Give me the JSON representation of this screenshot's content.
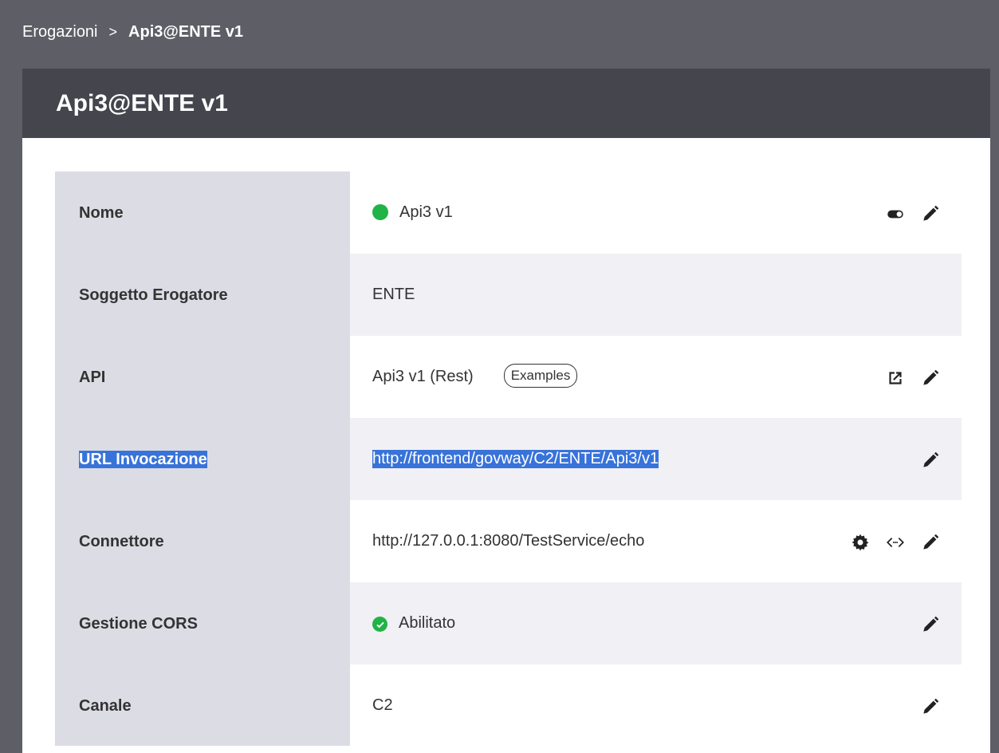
{
  "breadcrumb": {
    "parent": "Erogazioni",
    "separator": ">",
    "current": "Api3@ENTE v1"
  },
  "panel": {
    "title": "Api3@ENTE v1"
  },
  "rows": [
    {
      "label": "Nome",
      "value": "Api3 v1"
    },
    {
      "label": "Soggetto Erogatore",
      "value": "ENTE"
    },
    {
      "label": "API",
      "value": "Api3 v1 (Rest)",
      "tag": "Examples"
    },
    {
      "label": "URL Invocazione",
      "value": "http://frontend/govway/C2/ENTE/Api3/v1"
    },
    {
      "label": "Connettore",
      "value": "http://127.0.0.1:8080/TestService/echo"
    },
    {
      "label": "Gestione CORS",
      "value": "Abilitato"
    },
    {
      "label": "Canale",
      "value": "C2"
    }
  ],
  "icons": {
    "status": "status-dot-icon",
    "toggle": "toggle-icon",
    "edit": "pencil-icon",
    "open": "open-in-new-icon",
    "settings": "gear-icon",
    "code": "code-arrows-icon",
    "check": "check-circle-icon"
  },
  "colors": {
    "background": "#5d5e66",
    "header": "#44454d",
    "label_column": "#dcdce4",
    "alt_row": "#f0f0f5",
    "status_green": "#20b346",
    "selection": "#3873d9"
  }
}
